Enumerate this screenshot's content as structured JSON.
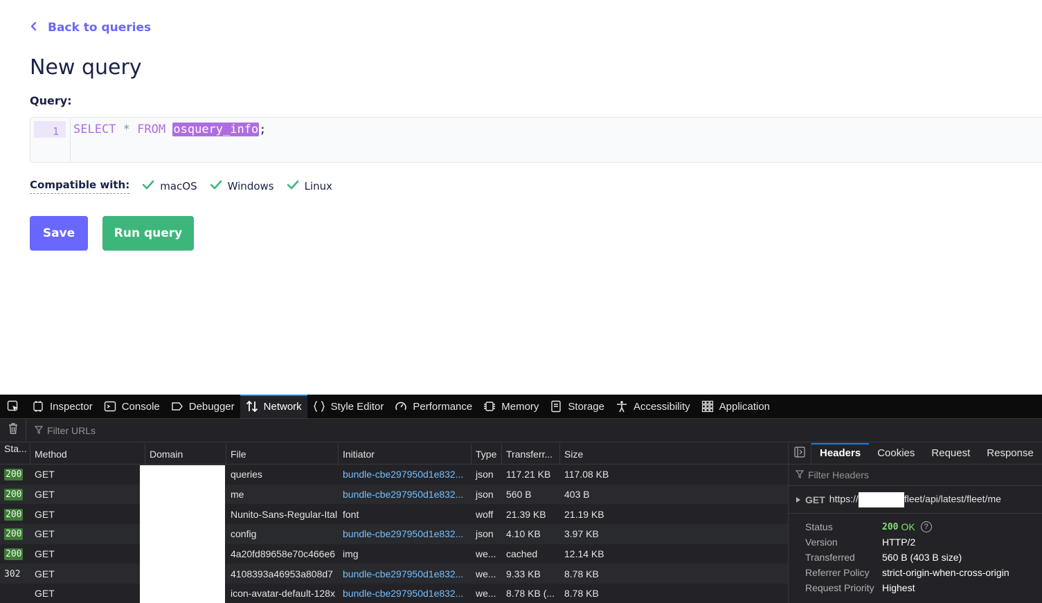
{
  "app": {
    "back_link": "Back to queries",
    "page_title": "New query",
    "query_label": "Query:",
    "editor": {
      "line_number": "1",
      "kw_select": "SELECT",
      "star": "*",
      "kw_from": "FROM",
      "table": "osquery_info",
      "semicolon": ";"
    },
    "compatible_label": "Compatible with:",
    "platforms": [
      "macOS",
      "Windows",
      "Linux"
    ],
    "save_label": "Save",
    "run_label": "Run query",
    "colors": {
      "accent": "#6a67fe",
      "run": "#3db67b",
      "check": "#3db67b",
      "keyword": "#ae6ddf"
    }
  },
  "devtools": {
    "tabs": [
      "Inspector",
      "Console",
      "Debugger",
      "Network",
      "Style Editor",
      "Performance",
      "Memory",
      "Storage",
      "Accessibility",
      "Application"
    ],
    "active_tab": "Network",
    "filter_placeholder": "Filter URLs",
    "columns": [
      "Sta...",
      "Method",
      "Domain",
      "File",
      "Initiator",
      "Type",
      "Transferr...",
      "Size"
    ],
    "rows": [
      {
        "status": "200",
        "method": "GET",
        "file": "queries",
        "initiator": "bundle-cbe297950d1e832...",
        "initiator_link": true,
        "type": "json",
        "transferred": "117.21 KB",
        "size": "117.08 KB"
      },
      {
        "status": "200",
        "method": "GET",
        "file": "me",
        "initiator": "bundle-cbe297950d1e832...",
        "initiator_link": true,
        "type": "json",
        "transferred": "560 B",
        "size": "403 B"
      },
      {
        "status": "200",
        "method": "GET",
        "file": "Nunito-Sans-Regular-Ital",
        "initiator": "font",
        "initiator_link": false,
        "type": "woff",
        "transferred": "21.39 KB",
        "size": "21.19 KB"
      },
      {
        "status": "200",
        "method": "GET",
        "file": "config",
        "initiator": "bundle-cbe297950d1e832...",
        "initiator_link": true,
        "type": "json",
        "transferred": "4.10 KB",
        "size": "3.97 KB"
      },
      {
        "status": "200",
        "method": "GET",
        "file": "4a20fd89658e70c466e6",
        "initiator": "img",
        "initiator_link": false,
        "type": "we...",
        "transferred": "cached",
        "size": "12.14 KB"
      },
      {
        "status": "302",
        "method": "GET",
        "file": "4108393a46953a808d7",
        "initiator": "bundle-cbe297950d1e832...",
        "initiator_link": true,
        "type": "we...",
        "transferred": "9.33 KB",
        "size": "8.78 KB"
      },
      {
        "status": "",
        "method": "GET",
        "file": "icon-avatar-default-128x",
        "initiator": "bundle-cbe297950d1e832...",
        "initiator_link": true,
        "type": "we...",
        "transferred": "8.78 KB (...",
        "size": "8.78 KB"
      }
    ],
    "sidebar": {
      "tabs": [
        "Headers",
        "Cookies",
        "Request",
        "Response"
      ],
      "active_tab": "Headers",
      "filter_placeholder": "Filter Headers",
      "summary_method": "GET",
      "summary_url_prefix": "https://",
      "summary_url_suffix": "fleet/api/latest/fleet/me",
      "details": [
        {
          "key": "Status",
          "value": "OK",
          "code": "200"
        },
        {
          "key": "Version",
          "value": "HTTP/2"
        },
        {
          "key": "Transferred",
          "value": "560 B (403 B size)"
        },
        {
          "key": "Referrer Policy",
          "value": "strict-origin-when-cross-origin"
        },
        {
          "key": "Request Priority",
          "value": "Highest"
        }
      ]
    }
  }
}
